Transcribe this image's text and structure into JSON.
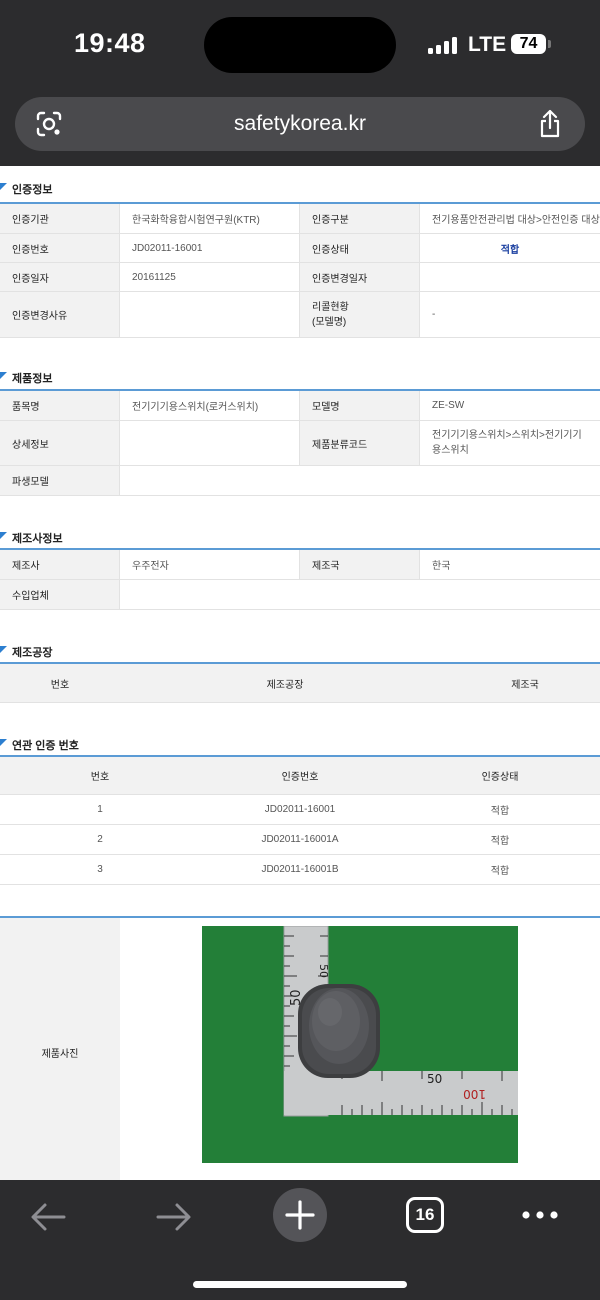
{
  "status_bar": {
    "time": "19:48",
    "network": "LTE",
    "battery": "74"
  },
  "browser": {
    "url": "safetykorea.kr",
    "tab_count": "16"
  },
  "cert_info": {
    "title": "인증정보",
    "rows": [
      {
        "l1": "인증기관",
        "v1": "한국화학융합시험연구원(KTR)",
        "l2": "인증구분",
        "v2": "전기용품안전관리법 대상>안전인증 대상"
      },
      {
        "l1": "인증번호",
        "v1": "JD02011-16001",
        "l2": "인증상태",
        "v2": "적합"
      },
      {
        "l1": "인증일자",
        "v1": "20161125",
        "l2": "인증변경일자",
        "v2": ""
      },
      {
        "l1": "인증변경사유",
        "v1": "",
        "l2": "리콜현황\n(모델명)",
        "v2": "-"
      }
    ]
  },
  "product_info": {
    "title": "제품정보",
    "rows": [
      {
        "l1": "품목명",
        "v1": "전기기기용스위치(로커스위치)",
        "l2": "모델명",
        "v2": "ZE-SW"
      },
      {
        "l1": "상세정보",
        "v1": "",
        "l2": "제품분류코드",
        "v2": "전기기기용스위치>스위치>전기기기용스위치"
      },
      {
        "l1": "파생모델",
        "v1": ""
      }
    ]
  },
  "maker_info": {
    "title": "제조사정보",
    "rows": [
      {
        "l1": "제조사",
        "v1": "우주전자",
        "l2": "제조국",
        "v2": "한국"
      },
      {
        "l1": "수입업체",
        "v1": ""
      }
    ]
  },
  "factory": {
    "title": "제조공장",
    "headers": [
      "번호",
      "제조공장",
      "제조국"
    ]
  },
  "related": {
    "title": "연관 인증 번호",
    "headers": [
      "번호",
      "인증번호",
      "인증상태"
    ],
    "rows": [
      {
        "no": "1",
        "cert": "JD02011-16001",
        "status": "적합"
      },
      {
        "no": "2",
        "cert": "JD02011-16001A",
        "status": "적합"
      },
      {
        "no": "3",
        "cert": "JD02011-16001B",
        "status": "적합"
      }
    ]
  },
  "photo": {
    "label": "제품사진",
    "ruler_marks": [
      "50",
      "50",
      "50",
      "100"
    ]
  },
  "colors": {
    "accent": "#2c7fd0",
    "section_line": "#5b9bd5",
    "status_ok": "#1a3fa0",
    "photo_bg": "#1f7a35"
  }
}
